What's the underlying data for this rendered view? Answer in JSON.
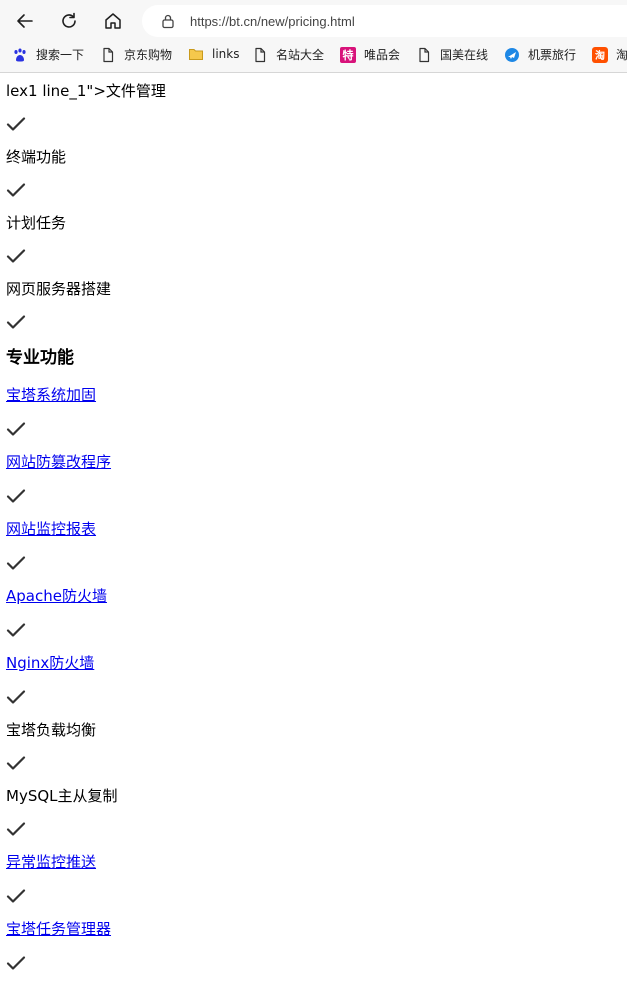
{
  "browser": {
    "url": "https://bt.cn/new/pricing.html",
    "bookmarks": [
      {
        "label": "搜索一下",
        "icon": "baidu-paw-icon"
      },
      {
        "label": "京东购物",
        "icon": "page-icon"
      },
      {
        "label": "links",
        "icon": "folder-icon"
      },
      {
        "label": "名站大全",
        "icon": "page-icon"
      },
      {
        "label": "唯品会",
        "icon": "vip-te-icon",
        "icon_text": "特"
      },
      {
        "label": "国美在线",
        "icon": "page-icon"
      },
      {
        "label": "机票旅行",
        "icon": "flight-icon"
      },
      {
        "label": "淘",
        "icon": "taobao-icon",
        "icon_text": "淘"
      }
    ]
  },
  "page": {
    "intro_rows": [
      {
        "text": "lex1 line_1\">文件管理",
        "link": false
      },
      {
        "text": "终端功能",
        "link": false
      },
      {
        "text": "计划任务",
        "link": false
      },
      {
        "text": "网页服务器搭建",
        "link": false
      }
    ],
    "section_title": "专业功能",
    "pro_rows": [
      {
        "text": "宝塔系统加固",
        "link": true
      },
      {
        "text": "网站防篡改程序",
        "link": true
      },
      {
        "text": "网站监控报表",
        "link": true
      },
      {
        "text": "Apache防火墙",
        "link": true
      },
      {
        "text": "Nginx防火墙",
        "link": true
      },
      {
        "text": "宝塔负载均衡",
        "link": false
      },
      {
        "text": "MySQL主从复制",
        "link": false
      },
      {
        "text": "异常监控推送",
        "link": true
      },
      {
        "text": "宝塔任务管理器",
        "link": true
      }
    ]
  }
}
